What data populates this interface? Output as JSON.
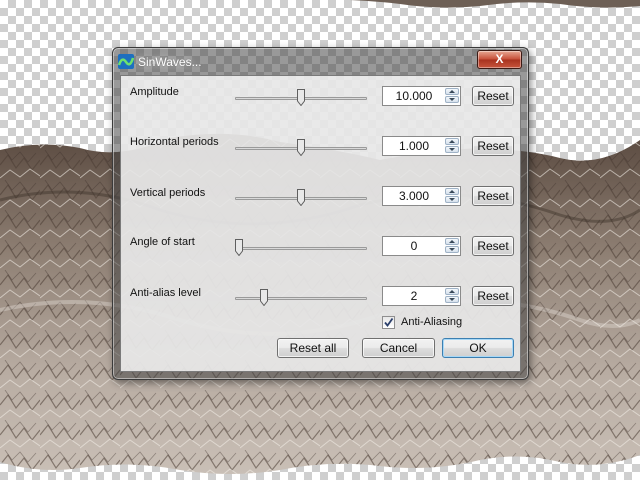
{
  "window": {
    "title": "SinWaves...",
    "close_label": "X"
  },
  "params": [
    {
      "label": "Amplitude",
      "value": "10.000",
      "slider_fraction": 0.5,
      "reset_label": "Reset"
    },
    {
      "label": "Horizontal periods",
      "value": "1.000",
      "slider_fraction": 0.5,
      "reset_label": "Reset"
    },
    {
      "label": "Vertical periods",
      "value": "3.000",
      "slider_fraction": 0.5,
      "reset_label": "Reset"
    },
    {
      "label": "Angle of start",
      "value": "0",
      "slider_fraction": 0.0,
      "reset_label": "Reset"
    },
    {
      "label": "Anti-alias level",
      "value": "2",
      "slider_fraction": 0.2,
      "reset_label": "Reset"
    }
  ],
  "anti_aliasing": {
    "label": "Anti-Aliasing",
    "checked": true
  },
  "buttons": {
    "reset_all": "Reset all",
    "cancel": "Cancel",
    "ok": "OK"
  },
  "colors": {
    "close_button": "#c8503a",
    "canvas_terrain": "#7d6e62"
  }
}
